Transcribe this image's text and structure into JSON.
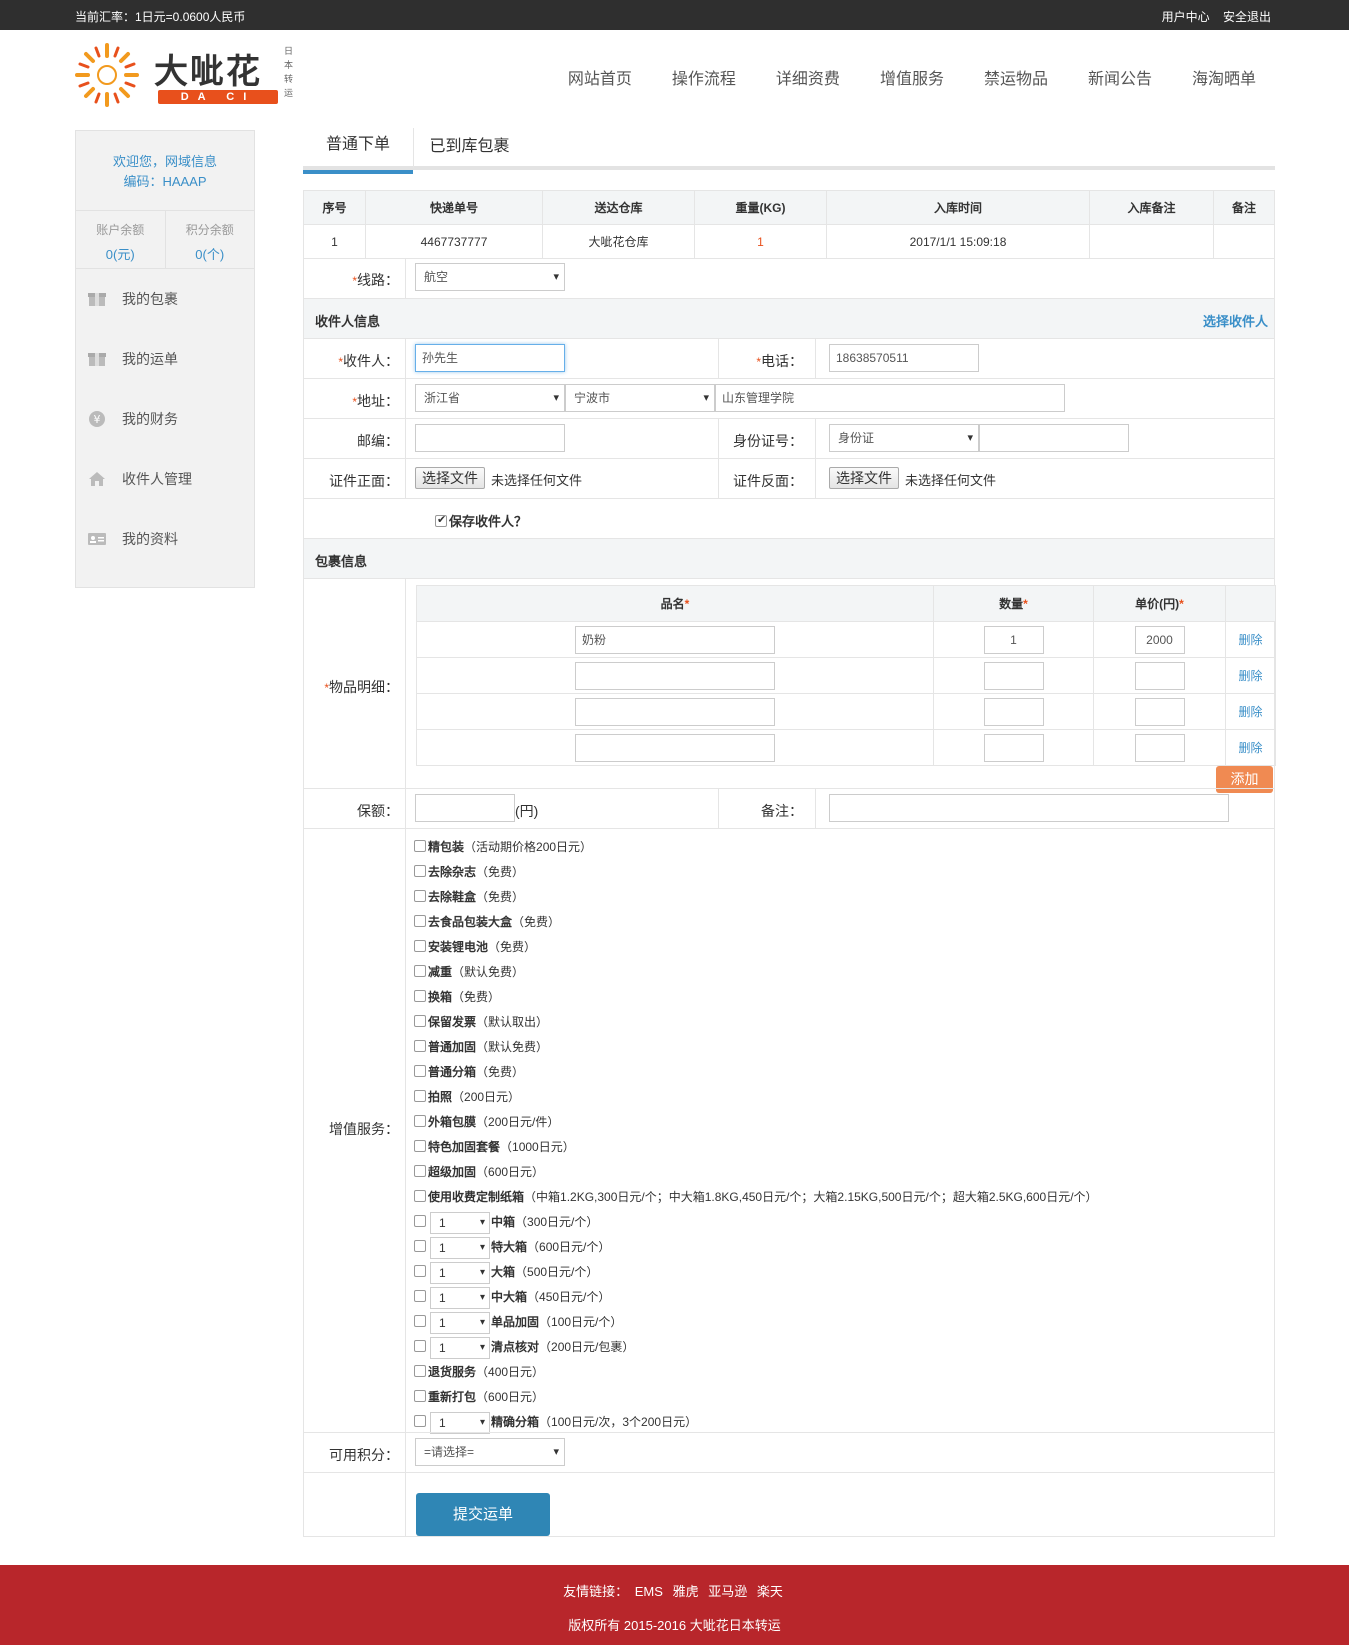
{
  "topbar": {
    "rate": "当前汇率：1日元=0.0600人民币",
    "user_center": "用户中心",
    "logout": "安全退出"
  },
  "logo": {
    "cn": "大呲花",
    "en": "DA CI HUA",
    "side": "日本转运"
  },
  "nav": [
    "网站首页",
    "操作流程",
    "详细资费",
    "增值服务",
    "禁运物品",
    "新闻公告",
    "海淘晒单"
  ],
  "sidebar": {
    "welcome": "欢迎您，网域信息",
    "code": "编码：HAAAP",
    "balance_label": "账户余额",
    "balance": "0(元)",
    "points_label": "积分余额",
    "points": "0(个)",
    "menu": [
      {
        "label": "我的包裹",
        "icon": "package-icon"
      },
      {
        "label": "我的运单",
        "icon": "waybill-icon"
      },
      {
        "label": "我的财务",
        "icon": "yen-icon"
      },
      {
        "label": "收件人管理",
        "icon": "home-icon"
      },
      {
        "label": "我的资料",
        "icon": "id-card-icon"
      }
    ]
  },
  "tabs": [
    "普通下单",
    "已到库包裹"
  ],
  "pkg_table": {
    "headers": [
      "序号",
      "快递单号",
      "送达仓库",
      "重量(KG)",
      "入库时间",
      "入库备注",
      "备注"
    ],
    "row": [
      "1",
      "4467737777",
      "大呲花仓库",
      "1",
      "2017/1/1 15:09:18",
      "",
      ""
    ]
  },
  "form": {
    "route_label": "线路：",
    "route_value": "航空",
    "recipient_section": "收件人信息",
    "choose_recipient": "选择收件人",
    "recipient_label": "收件人：",
    "recipient_value": "孙先生",
    "phone_label": "电话：",
    "phone_value": "18638570511",
    "address_label": "地址：",
    "province": "浙江省",
    "city": "宁波市",
    "address_value": "山东管理学院",
    "zip_label": "邮编：",
    "zip_value": "",
    "id_label": "身份证号：",
    "id_type": "身份证",
    "id_value": "",
    "id_front_label": "证件正面：",
    "id_back_label": "证件反面：",
    "file_button": "选择文件",
    "file_none": "未选择任何文件",
    "save_recipient": "保存收件人？",
    "package_section": "包裹信息",
    "items_label": "物品明细：",
    "items_headers": [
      "品名",
      "数量",
      "单价(円)"
    ],
    "items": [
      {
        "name": "奶粉",
        "qty": "1",
        "price": "2000"
      },
      {
        "name": "",
        "qty": "",
        "price": ""
      },
      {
        "name": "",
        "qty": "",
        "price": ""
      },
      {
        "name": "",
        "qty": "",
        "price": ""
      }
    ],
    "delete": "删除",
    "add": "添加",
    "insurance_label": "保额：",
    "insurance_unit": "(円)",
    "remark_label": "备注：",
    "services_label": "增值服务：",
    "services": [
      {
        "name": "精包装",
        "note": "（活动期价格200日元）"
      },
      {
        "name": "去除杂志",
        "note": "（免费）"
      },
      {
        "name": "去除鞋盒",
        "note": "（免费）"
      },
      {
        "name": "去食品包装大盒",
        "note": "（免费）"
      },
      {
        "name": "安装锂电池",
        "note": "（免费）"
      },
      {
        "name": "减重",
        "note": "（默认免费）"
      },
      {
        "name": "换箱",
        "note": "（免费）"
      },
      {
        "name": "保留发票",
        "note": "（默认取出）"
      },
      {
        "name": "普通加固",
        "note": "（默认免费）"
      },
      {
        "name": "普通分箱",
        "note": "（免费）"
      },
      {
        "name": "拍照",
        "note": "（200日元）"
      },
      {
        "name": "外箱包膜",
        "note": "（200日元/件）"
      },
      {
        "name": "特色加固套餐",
        "note": "（1000日元）"
      },
      {
        "name": "超级加固",
        "note": "（600日元）"
      },
      {
        "name": "使用收费定制纸箱",
        "note": "（中箱1.2KG,300日元/个；中大箱1.8KG,450日元/个；大箱2.15KG,500日元/个；超大箱2.5KG,600日元/个）"
      },
      {
        "name": "中箱",
        "note": "（300日元/个）",
        "qty": "1"
      },
      {
        "name": "特大箱",
        "note": "（600日元/个）",
        "qty": "1"
      },
      {
        "name": "大箱",
        "note": "（500日元/个）",
        "qty": "1"
      },
      {
        "name": "中大箱",
        "note": "（450日元/个）",
        "qty": "1"
      },
      {
        "name": "单品加固",
        "note": "（100日元/个）",
        "qty": "1"
      },
      {
        "name": "清点核对",
        "note": "（200日元/包裹）",
        "qty": "1"
      },
      {
        "name": "退货服务",
        "note": "（400日元）"
      },
      {
        "name": "重新打包",
        "note": "（600日元）"
      },
      {
        "name": "精确分箱",
        "note": "（100日元/次，3个200日元）",
        "qty": "1"
      }
    ],
    "points_label": "可用积分：",
    "points_value": "=请选择=",
    "submit": "提交运单"
  },
  "footer": {
    "links_label": "友情链接：",
    "links": [
      "EMS",
      "雅虎",
      "亚马逊",
      "楽天"
    ],
    "copyright": "版权所有 2015-2016 大呲花日本转运"
  },
  "colors": {
    "accent": "#3a8fc8",
    "orange": "#e8501c",
    "footer": "#b8262b",
    "submit": "#2f86b5"
  }
}
